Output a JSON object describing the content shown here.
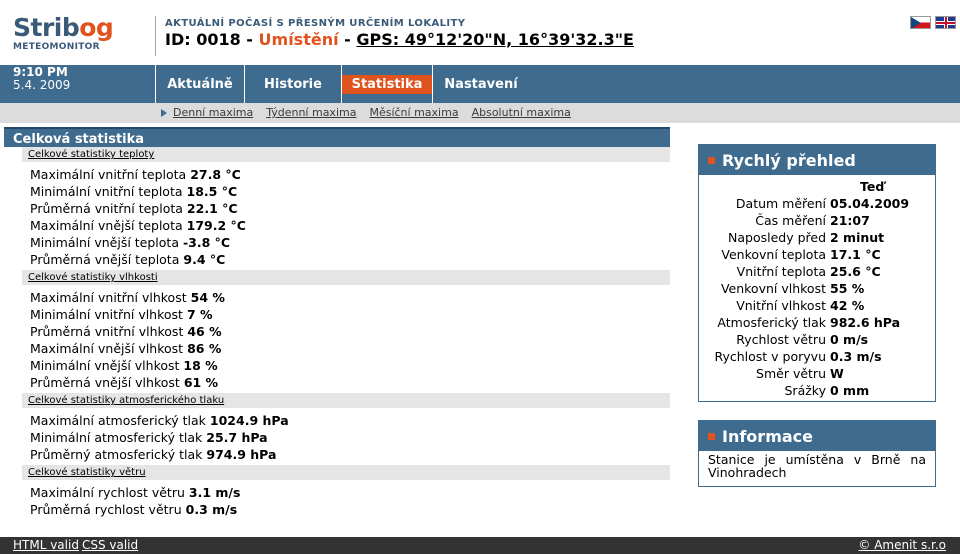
{
  "header": {
    "logo_main": "Strib",
    "logo_accent": "og",
    "logo_sub": "METEOMONITOR",
    "tagline": "AKTUÁLNÍ POČASÍ S PŘESNÝM URČENÍM LOKALITY",
    "id_text": "ID: 0018 -",
    "location_label": "Umístění",
    "dash": "-",
    "gps": "GPS: 49°12'20\"N, 16°39'32.3\"E",
    "languages": [
      "cz-flag-icon",
      "gb-flag-icon"
    ]
  },
  "nav": {
    "time": "9:10 PM",
    "date": "5.4. 2009",
    "tabs": [
      {
        "label": "Aktuálně",
        "active": false
      },
      {
        "label": "Historie",
        "active": false
      },
      {
        "label": "Statistika",
        "active": true
      },
      {
        "label": "Nastavení",
        "active": false
      }
    ],
    "active_color": "#e0521e",
    "bar_color": "#3e6b8e"
  },
  "subnav": {
    "links": [
      "Denní maxima",
      "Týdenní maxima",
      "Měsíční maxima",
      "Absolutní maxima"
    ]
  },
  "stats": {
    "title": "Celková statistika",
    "sections": [
      {
        "heading": "Celkové statistiky teploty",
        "rows": [
          {
            "label": "Maximální vnitřní teplota",
            "value": "27.8 °C"
          },
          {
            "label": "Minimální vnitřní teplota",
            "value": "18.5 °C"
          },
          {
            "label": "Průměrná vnitřní teplota",
            "value": "22.1 °C"
          },
          {
            "label": "Maximální vnější teplota",
            "value": "179.2 °C"
          },
          {
            "label": "Minimální vnější teplota",
            "value": "-3.8 °C"
          },
          {
            "label": "Průměrná vnější teplota",
            "value": "9.4 °C"
          }
        ]
      },
      {
        "heading": "Celkové statistiky vlhkosti",
        "rows": [
          {
            "label": "Maximální vnitřní vlhkost",
            "value": "54 %"
          },
          {
            "label": "Minimální vnitřní vlhkost",
            "value": "7 %"
          },
          {
            "label": "Průměrná vnitřní vlhkost",
            "value": "46 %"
          },
          {
            "label": "Maximální vnější vlhkost",
            "value": "86 %"
          },
          {
            "label": "Minimální vnější vlhkost",
            "value": "18 %"
          },
          {
            "label": "Průměrná vnější vlhkost",
            "value": "61 %"
          }
        ]
      },
      {
        "heading": "Celkové statistiky atmosferického tlaku",
        "rows": [
          {
            "label": "Maximální atmosferický tlak",
            "value": "1024.9 hPa"
          },
          {
            "label": "Minimální atmosferický tlak",
            "value": "25.7 hPa"
          },
          {
            "label": "Průměrný atmosferický tlak",
            "value": "974.9 hPa"
          }
        ]
      },
      {
        "heading": "Celkové statistiky větru",
        "rows": [
          {
            "label": "Maximální rychlost větru",
            "value": "3.1 m/s"
          },
          {
            "label": "Průměrná rychlost větru",
            "value": "0.3 m/s"
          }
        ]
      }
    ]
  },
  "quick": {
    "title": "Rychlý přehled",
    "column_head": "Teď",
    "rows": [
      {
        "label": "Datum měření",
        "value": "05.04.2009"
      },
      {
        "label": "Čas měření",
        "value": "21:07"
      },
      {
        "label": "Naposledy před",
        "value": "2 minut"
      },
      {
        "label": "Venkovní teplota",
        "value": "17.1 °C"
      },
      {
        "label": "Vnitřní teplota",
        "value": "25.6 °C"
      },
      {
        "label": "Venkovní vlhkost",
        "value": "55 %"
      },
      {
        "label": "Vnitřní vlhkost",
        "value": "42 %"
      },
      {
        "label": "Atmosferický tlak",
        "value": "982.6 hPa"
      },
      {
        "label": "Rychlost větru",
        "value": "0 m/s"
      },
      {
        "label": "Rychlost v poryvu",
        "value": "0.3 m/s"
      },
      {
        "label": "Směr větru",
        "value": "W"
      },
      {
        "label": "Srážky",
        "value": "0 mm"
      }
    ]
  },
  "info": {
    "title": "Informace",
    "text": "Stanice je umístěna v Brně na Vinohradech"
  },
  "footer": {
    "html_valid": "HTML valid",
    "css_valid": "CSS valid",
    "copyright": "© Amenit s.r.o"
  }
}
